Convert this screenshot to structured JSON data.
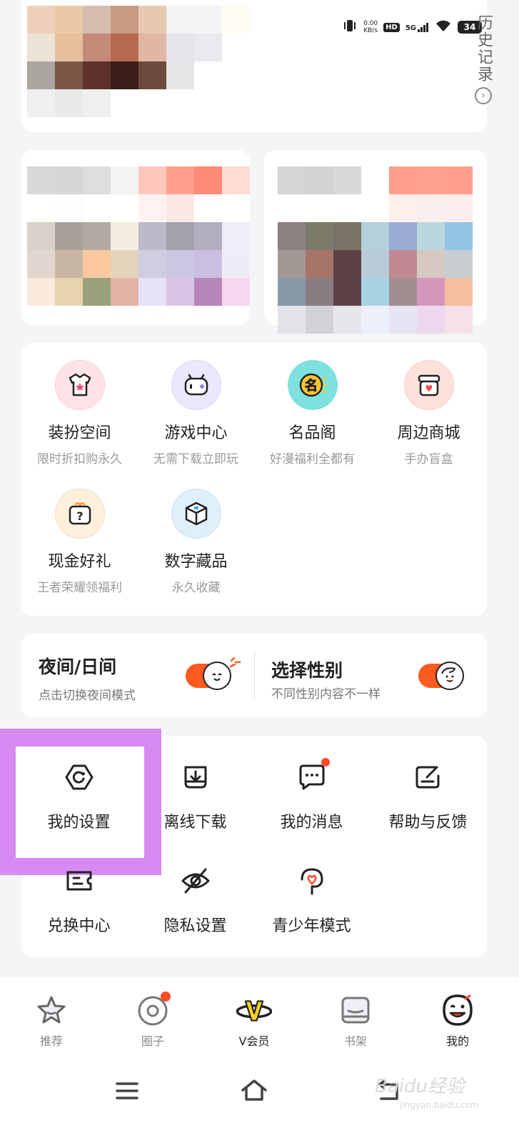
{
  "status_bar": {
    "speed_value": "0.00",
    "speed_unit": "KB/s",
    "hd": "HD",
    "network": "5G",
    "battery": "34"
  },
  "history": {
    "label": "历史记录",
    "arrow_icon": "chevron-right-circle-icon"
  },
  "menu": [
    {
      "title": "装扮空间",
      "subtitle": "限时折扣购永久",
      "icon": "shirt-star-icon",
      "color": "#ffe3e6"
    },
    {
      "title": "游戏中心",
      "subtitle": "无需下载立即玩",
      "icon": "gamepad-icon",
      "color": "#ece6ff"
    },
    {
      "title": "名品阁",
      "subtitle": "好漫福利全都有",
      "icon": "ming-badge-icon",
      "color": "#7fe0e0"
    },
    {
      "title": "周边商城",
      "subtitle": "手办盲盒",
      "icon": "shop-bag-icon",
      "color": "#ffe1dc"
    },
    {
      "title": "现金好礼",
      "subtitle": "王者荣耀领福利",
      "icon": "gift-question-icon",
      "color": "#fff0dc"
    },
    {
      "title": "数字藏品",
      "subtitle": "永久收藏",
      "icon": "cube-icon",
      "color": "#dff0fb"
    }
  ],
  "toggles": {
    "night": {
      "title": "夜间/日间",
      "subtitle": "点击切换夜间模式",
      "icon": "sun-face-icon"
    },
    "gender": {
      "title": "选择性别",
      "subtitle": "不同性别内容不一样",
      "icon": "girl-face-icon"
    }
  },
  "settings": [
    {
      "label": "我的设置",
      "icon": "settings-hexagon-icon"
    },
    {
      "label": "离线下载",
      "icon": "download-tray-icon"
    },
    {
      "label": "我的消息",
      "icon": "message-icon",
      "has_dot": true
    },
    {
      "label": "帮助与反馈",
      "icon": "edit-feedback-icon"
    },
    {
      "label": "兑换中心",
      "icon": "exchange-ticket-icon"
    },
    {
      "label": "隐私设置",
      "icon": "eye-off-icon"
    },
    {
      "label": "青少年模式",
      "icon": "youth-umbrella-icon"
    }
  ],
  "bottom_nav": [
    {
      "label": "推荐",
      "icon": "star-icon"
    },
    {
      "label": "圈子",
      "icon": "circle-icon",
      "has_dot": true
    },
    {
      "label": "V会员",
      "icon": "v-vip-icon"
    },
    {
      "label": "书架",
      "icon": "bookshelf-icon"
    },
    {
      "label": "我的",
      "icon": "profile-face-icon",
      "active": true
    }
  ],
  "system_nav": {
    "menu_icon": "menu-icon",
    "home_icon": "home-icon",
    "back_icon": "back-icon"
  },
  "watermark": {
    "main": "Baidu经验",
    "sub": "jingyan.baidu.com"
  },
  "colors": {
    "accent": "#ff5a1f",
    "highlight": "#d68af2",
    "dot": "#ff4a2a"
  }
}
